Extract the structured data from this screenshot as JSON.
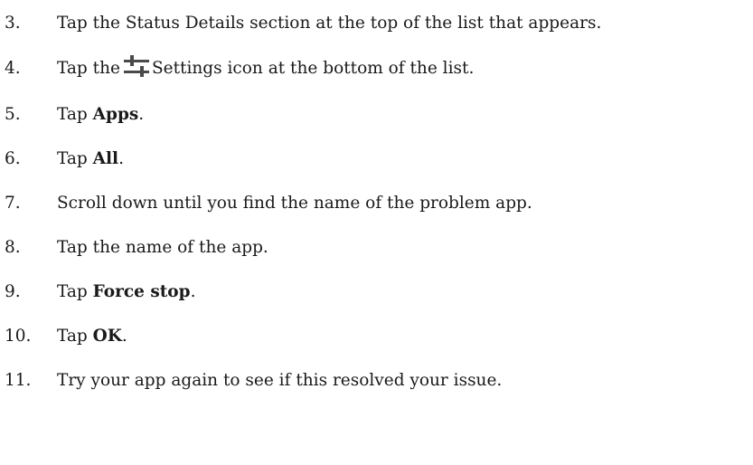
{
  "steps": [
    {
      "number": "3.",
      "text": "Tap the Status Details section at the top of the list that appears."
    },
    {
      "number": "4.",
      "before": "Tap the",
      "icon": "settings-sliders-icon",
      "after": "Settings icon at the bottom of the list."
    },
    {
      "number": "5.",
      "before": "Tap ",
      "bold": "Apps",
      "after": "."
    },
    {
      "number": "6.",
      "before": "Tap ",
      "bold": "All",
      "after": "."
    },
    {
      "number": "7.",
      "text": "Scroll down until you find the name of the problem app."
    },
    {
      "number": "8.",
      "text": "Tap the name of the app."
    },
    {
      "number": "9.",
      "before": "Tap ",
      "bold": "Force stop",
      "after": "."
    },
    {
      "number": "10.",
      "before": "Tap ",
      "bold": "OK",
      "after": "."
    },
    {
      "number": "11.",
      "text": "Try your app again to see if this resolved your issue."
    }
  ]
}
